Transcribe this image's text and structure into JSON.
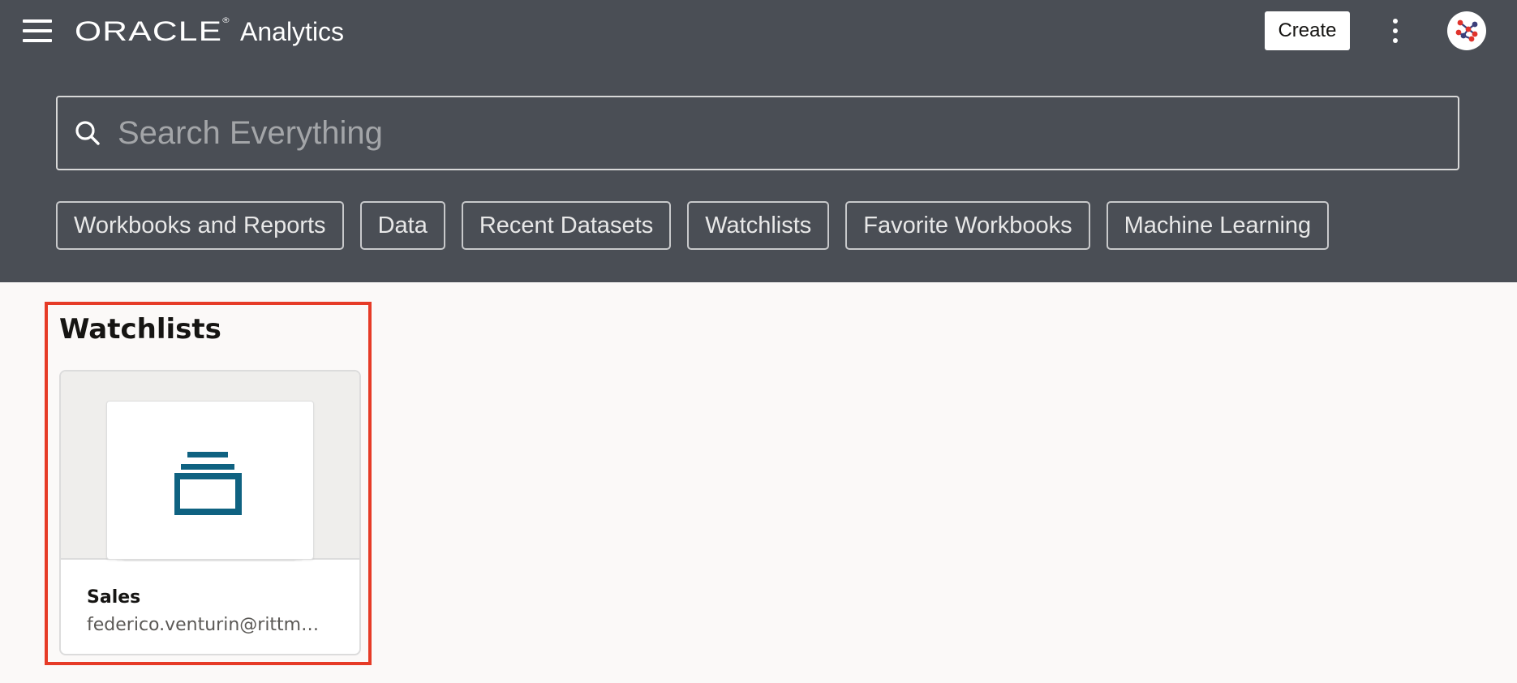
{
  "header": {
    "brand_logo": "ORACLE",
    "product_name": "Analytics",
    "create_label": "Create",
    "menu_icon": "hamburger-menu-icon",
    "more_icon": "more-vertical-icon",
    "avatar_icon": "user-avatar-icon"
  },
  "search": {
    "placeholder": "Search Everything",
    "icon": "search-icon"
  },
  "filters": [
    {
      "label": "Workbooks and Reports"
    },
    {
      "label": "Data"
    },
    {
      "label": "Recent Datasets"
    },
    {
      "label": "Watchlists"
    },
    {
      "label": "Favorite Workbooks"
    },
    {
      "label": "Machine Learning"
    }
  ],
  "section": {
    "title": "Watchlists",
    "highlight_color": "#e63b27",
    "cards": [
      {
        "name": "Sales",
        "owner": "federico.venturin@rittm…",
        "icon": "watchlist-icon"
      }
    ]
  },
  "colors": {
    "header_bg": "#4a4e55",
    "page_bg": "#fbf9f8",
    "accent": "#0f6281"
  }
}
